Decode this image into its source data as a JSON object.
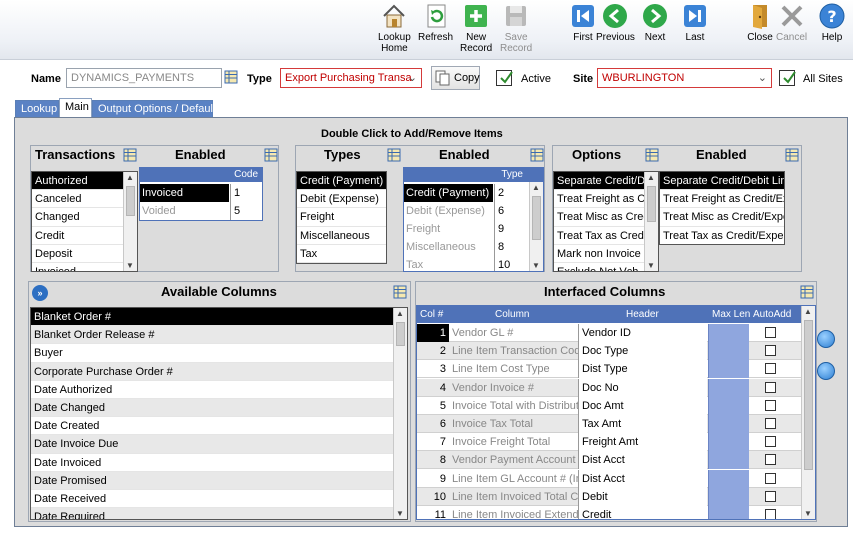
{
  "toolbar": {
    "lookup_home": "Lookup\nHome",
    "refresh": "Refresh",
    "new_record": "New\nRecord",
    "save_record": "Save\nRecord",
    "first": "First",
    "previous": "Previous",
    "next": "Next",
    "last": "Last",
    "close": "Close",
    "cancel": "Cancel",
    "help": "Help"
  },
  "header": {
    "name_label": "Name",
    "name_value": "DYNAMICS_PAYMENTS",
    "type_label": "Type",
    "type_value": "Export Purchasing Transa",
    "copy_label": "Copy",
    "active_label": "Active",
    "active_checked": true,
    "site_label": "Site",
    "site_value": "WBURLINGTON",
    "all_sites_label": "All Sites",
    "all_sites_checked": true
  },
  "tabs": {
    "lookup": "Lookup",
    "main": "Main",
    "output": "Output Options / Defaults"
  },
  "main": {
    "instruction": "Double Click to Add/Remove Items",
    "transactions": {
      "title": "Transactions",
      "items": [
        "Authorized",
        "Canceled",
        "Changed",
        "Credit",
        "Deposit",
        "Invoiced"
      ],
      "enabled_title": "Enabled",
      "code_header": "Code",
      "enabled_rows": [
        {
          "name": "Invoiced",
          "code": "1"
        },
        {
          "name": "Voided",
          "code": "5"
        }
      ]
    },
    "types": {
      "title": "Types",
      "items": [
        "Credit (Payment)",
        "Debit (Expense)",
        "Freight",
        "Miscellaneous",
        "Tax"
      ],
      "enabled_title": "Enabled",
      "type_header": "Type",
      "enabled_rows": [
        {
          "name": "Credit (Payment)",
          "code": "2"
        },
        {
          "name": "Debit (Expense)",
          "code": "6"
        },
        {
          "name": "Freight",
          "code": "9"
        },
        {
          "name": "Miscellaneous",
          "code": "8"
        },
        {
          "name": "Tax",
          "code": "10"
        }
      ]
    },
    "options": {
      "title": "Options",
      "items": [
        "Separate Credit/De",
        "Treat Freight as Cr",
        "Treat Misc as Cred",
        "Treat Tax as Credit",
        "Mark non Invoice tr",
        "Exclude Not Vch"
      ],
      "enabled_title": "Enabled",
      "enabled_items": [
        "Separate Credit/Debit Line",
        "Treat Freight as Credit/Exp",
        "Treat Misc as Credit/Exper",
        "Treat Tax as Credit/Expens"
      ]
    },
    "available_columns": {
      "title": "Available Columns",
      "items": [
        "Blanket Order #",
        "Blanket Order Release #",
        "Buyer",
        "Corporate Purchase Order #",
        "Date Authorized",
        "Date Changed",
        "Date Created",
        "Date Invoice Due",
        "Date Invoiced",
        "Date Promised",
        "Date Received",
        "Date Required"
      ]
    },
    "interfaced_columns": {
      "title": "Interfaced Columns",
      "headers": {
        "col": "Col #",
        "column": "Column",
        "header": "Header",
        "maxlen": "Max Len",
        "autoadd": "AutoAdd"
      },
      "rows": [
        {
          "num": "1",
          "column": "Vendor GL #",
          "header": "Vendor ID"
        },
        {
          "num": "2",
          "column": "Line Item Transaction Code",
          "header": "Doc Type"
        },
        {
          "num": "3",
          "column": "Line Item Cost Type",
          "header": "Dist Type"
        },
        {
          "num": "4",
          "column": "Vendor Invoice #",
          "header": "Doc No"
        },
        {
          "num": "5",
          "column": "Invoice Total with Distributio",
          "header": "Doc Amt"
        },
        {
          "num": "6",
          "column": "Invoice Tax Total",
          "header": "Tax Amt"
        },
        {
          "num": "7",
          "column": "Invoice Freight Total",
          "header": "Freight Amt"
        },
        {
          "num": "8",
          "column": "Vendor Payment Account",
          "header": "Dist Acct"
        },
        {
          "num": "9",
          "column": "Line Item GL Account # (Inv",
          "header": "Dist Acct"
        },
        {
          "num": "10",
          "column": "Line Item Invoiced Total Co",
          "header": "Debit"
        },
        {
          "num": "11",
          "column": "Line Item Invoiced Extende",
          "header": "Credit"
        }
      ]
    }
  },
  "colors": {
    "accent_blue": "#4f72b8",
    "required_red": "#d43a3a",
    "maxlen_fill": "#8fa6de"
  }
}
